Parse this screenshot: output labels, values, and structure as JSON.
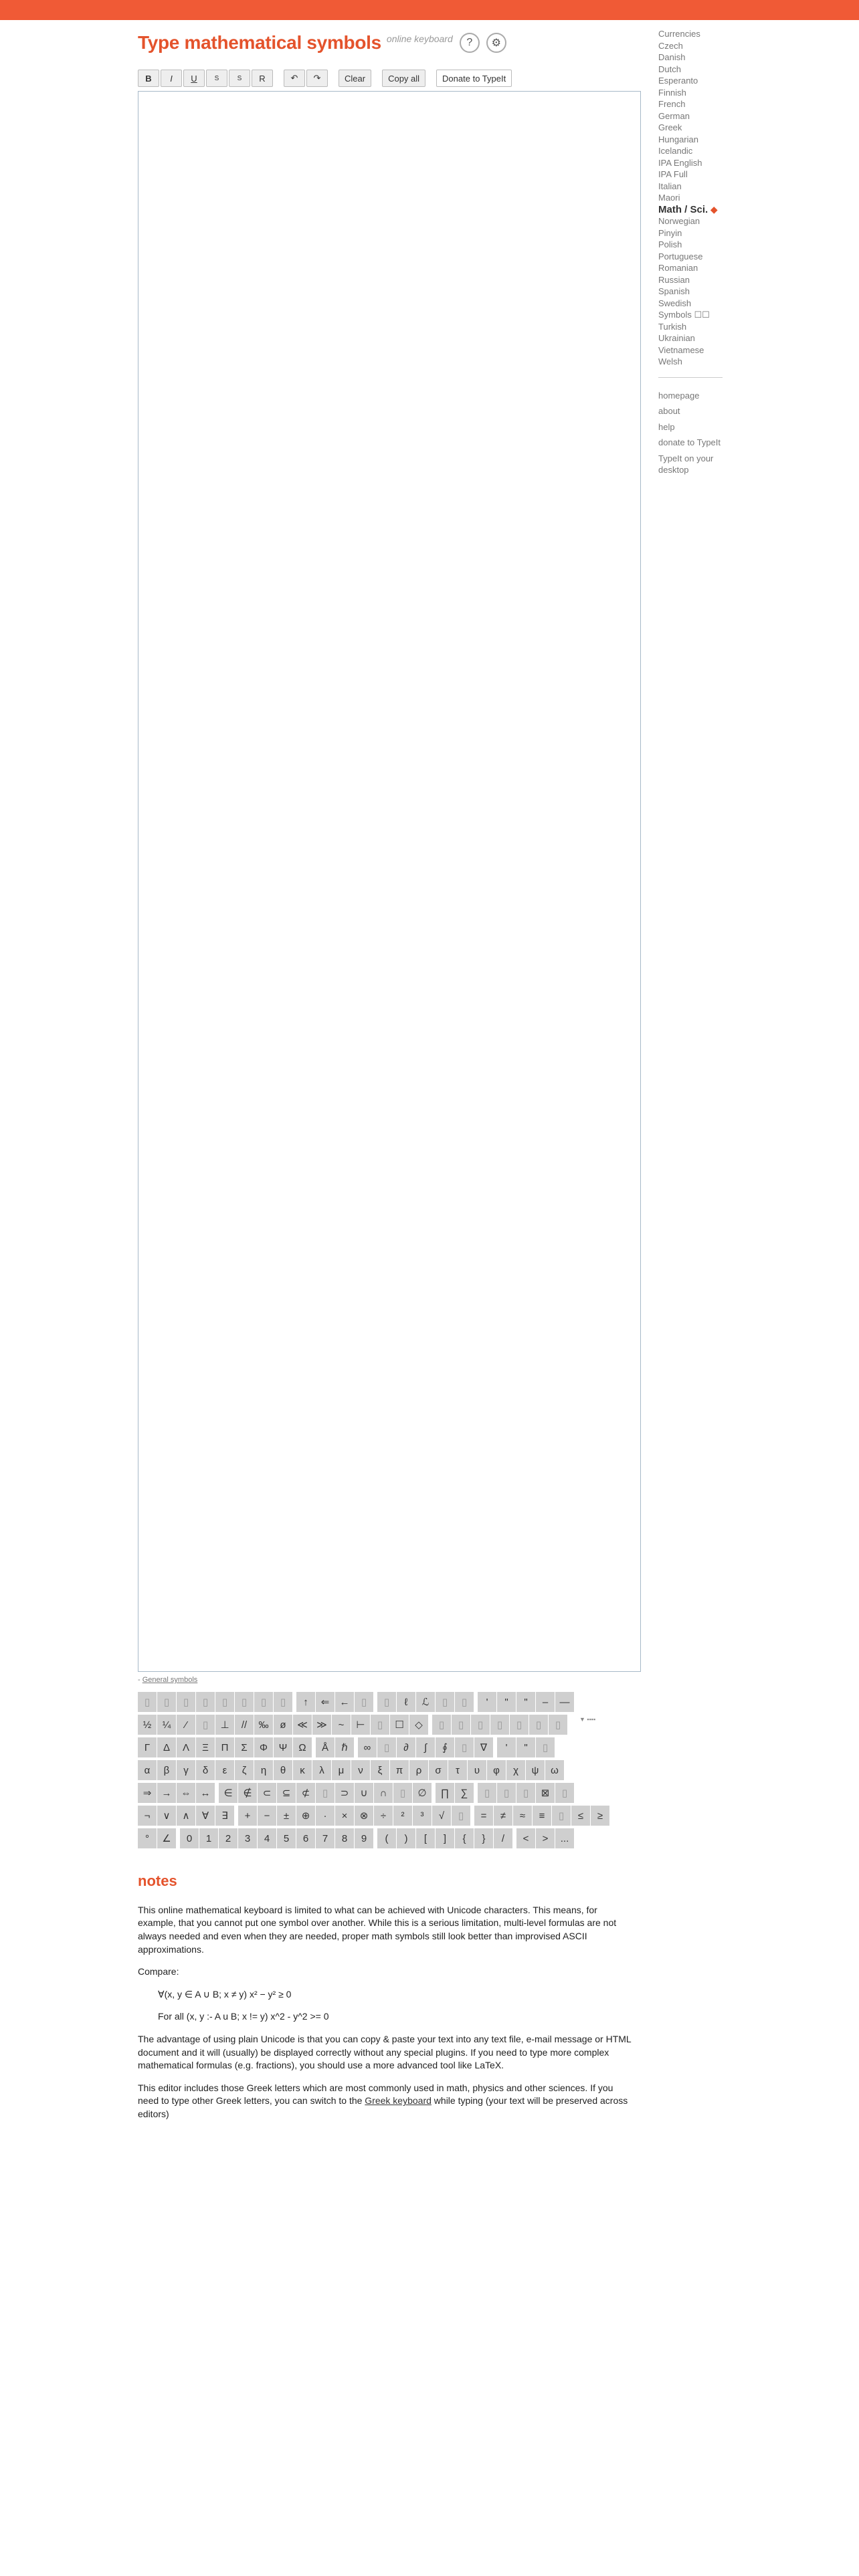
{
  "header": {
    "title": "Type mathematical symbols",
    "subtitle": "online keyboard",
    "help_icon": "question-icon",
    "settings_icon": "gear-icon"
  },
  "toolbar": {
    "bold": "B",
    "italic": "I",
    "underline": "U",
    "superscript": "S",
    "subscript": "S",
    "reset": "R",
    "undo": "↶",
    "redo": "↷",
    "clear": "Clear",
    "copy_all": "Copy all",
    "donate": "Donate to TypeIt"
  },
  "editor": {
    "value": ""
  },
  "keyboard": {
    "label": "General symbols",
    "tiny_note": "▼ ▪▪▪▪",
    "rows": [
      [
        "▯",
        "▯",
        "▯",
        "▯",
        "▯",
        "▯",
        "▯",
        "▯",
        "|",
        "↑",
        "⇐",
        "←",
        "▯",
        "|",
        "▯",
        "ℓ",
        "ℒ",
        "▯",
        "▯",
        "|",
        "'",
        "\"",
        "\"",
        "–",
        "—"
      ],
      [
        "½",
        "¼",
        "⁄",
        "▯",
        "⊥",
        "//",
        "‰",
        "ø",
        "≪",
        "≫",
        "~",
        "⊢",
        "▯",
        "☐",
        "◇",
        "|",
        "▯",
        "▯",
        "▯",
        "▯",
        "▯",
        "▯",
        "▯"
      ],
      [
        "Γ",
        "Δ",
        "Λ",
        "Ξ",
        "Π",
        "Σ",
        "Φ",
        "Ψ",
        "Ω",
        "|",
        "Å",
        "ℏ",
        "|",
        "∞",
        "▯",
        "∂",
        "∫",
        "∮",
        "▯",
        "∇",
        "|",
        "'",
        "\"",
        "▯"
      ],
      [
        "α",
        "β",
        "γ",
        "δ",
        "ε",
        "ζ",
        "η",
        "θ",
        "κ",
        "λ",
        "μ",
        "ν",
        "ξ",
        "π",
        "ρ",
        "σ",
        "τ",
        "υ",
        "φ",
        "χ",
        "ψ",
        "ω"
      ],
      [
        "⇒",
        "→",
        "⇔",
        "↔",
        "|",
        "∈",
        "∉",
        "⊂",
        "⊆",
        "⊄",
        "▯",
        "⊃",
        "∪",
        "∩",
        "▯",
        "∅",
        "|",
        "∏",
        "∑",
        "|",
        "▯",
        "▯",
        "▯",
        "⊠",
        "▯"
      ],
      [
        "¬",
        "∨",
        "∧",
        "∀",
        "∃",
        "|",
        "+",
        "−",
        "±",
        "⊕",
        "·",
        "×",
        "⊗",
        "÷",
        "²",
        "³",
        "√",
        "▯",
        "|",
        "=",
        "≠",
        "≈",
        "≡",
        "▯",
        "≤",
        "≥"
      ],
      [
        "°",
        "∠",
        "|",
        "0",
        "1",
        "2",
        "3",
        "4",
        "5",
        "6",
        "7",
        "8",
        "9",
        "|",
        "(",
        ")",
        "[",
        "]",
        "{",
        "}",
        "/",
        "|",
        "<",
        ">",
        "..."
      ]
    ]
  },
  "notes": {
    "heading": "notes",
    "p1": "This online mathematical keyboard is limited to what can be achieved with Unicode characters. This means, for example, that you cannot put one symbol over another. While this is a serious limitation, multi-level formulas are not always needed and even when they are needed, proper math symbols still look better than improvised ASCII approximations.",
    "compare": "Compare:",
    "ex1": "∀(x, y ∈ A ∪ B; x ≠ y) x² − y² ≥ 0",
    "ex2": "For all (x, y :- A u B; x != y) x^2 - y^2 >= 0",
    "p2": "The advantage of using plain Unicode is that you can copy & paste your text into any text file, e-mail message or HTML document and it will (usually) be displayed correctly without any special plugins. If you need to type more complex mathematical formulas (e.g. fractions), you should use a more advanced tool like LaTeX.",
    "p3_before": "This editor includes those Greek letters which are most commonly used in math, physics and other sciences. If you need to type other Greek letters, you can switch to the ",
    "p3_link": "Greek keyboard",
    "p3_after": " while typing (your text will be preserved across editors)"
  },
  "sidebar": {
    "languages": [
      "Currencies",
      "Czech",
      "Danish",
      "Dutch",
      "Esperanto",
      "Finnish",
      "French",
      "German",
      "Greek",
      "Hungarian",
      "Icelandic",
      "IPA English",
      "IPA Full",
      "Italian",
      "Maori"
    ],
    "active": "Math / Sci.",
    "active_marker": "◆",
    "languages_after": [
      "Norwegian",
      "Pinyin",
      "Polish",
      "Portuguese",
      "Romanian",
      "Russian",
      "Spanish",
      "Swedish",
      "Symbols ☐☐",
      "Turkish",
      "Ukrainian",
      "Vietnamese",
      "Welsh"
    ],
    "links": [
      "homepage",
      "about",
      "help",
      "donate to TypeIt",
      "TypeIt on your desktop"
    ]
  }
}
